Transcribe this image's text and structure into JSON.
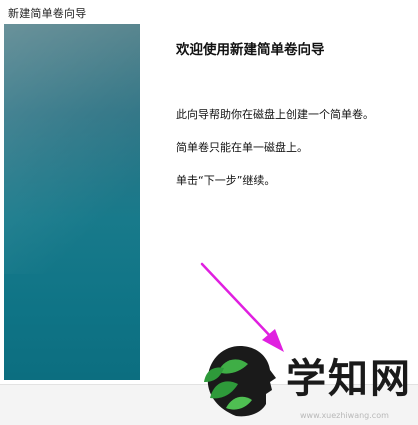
{
  "window": {
    "title": "新建简单卷向导"
  },
  "wizard": {
    "heading": "欢迎使用新建简单卷向导",
    "paragraphs": [
      "此向导帮助你在磁盘上创建一个简单卷。",
      "简单卷只能在单一磁盘上。",
      "单击“下一步”继续。"
    ]
  },
  "footer": {
    "text": "www.xuezhiwang.com"
  },
  "watermark": {
    "text": "学知网"
  },
  "colors": {
    "sidebar_top": "#4a7b85",
    "sidebar_bottom": "#0c6e80",
    "arrow": "#e020e0",
    "logo_green": "#2e9a3a"
  },
  "icons": {
    "annotation": "arrow-annotation-icon",
    "logo": "leaf-head-logo-icon"
  }
}
